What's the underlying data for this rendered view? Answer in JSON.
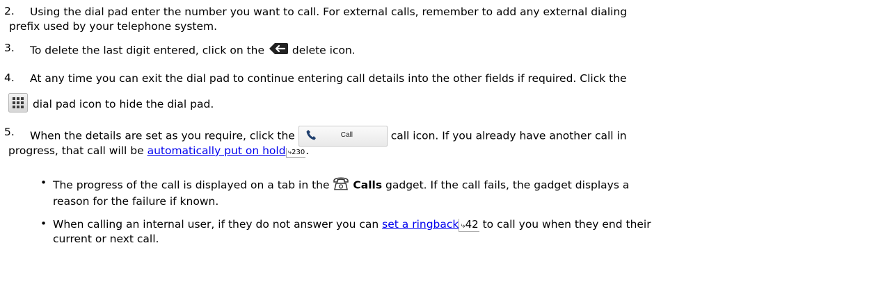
{
  "steps": [
    {
      "number": "2.",
      "line1": "Using the dial pad enter the number you want to call. For external calls, remember to add any external dialing",
      "line2": "prefix used by your telephone system."
    },
    {
      "number": "3.",
      "before": "To delete the last digit entered, click on the",
      "after": "delete icon."
    },
    {
      "number": "4.",
      "line1": "At any time you can exit the dial pad to continue entering call details into the other fields if required. Click the",
      "line2": "dial pad icon to hide the dial pad."
    },
    {
      "number": "5.",
      "before": "When the details are set as you require, click the",
      "button_label": "Call",
      "after": "call icon. If you already have another call in",
      "line2_before": "progress, that call will be",
      "link": "automatically put on hold",
      "link_ref": "230",
      "line2_after": "."
    }
  ],
  "bullets": [
    {
      "dot": "•",
      "before": "The progress of the call is displayed on a tab in the",
      "bold": "Calls",
      "after": "gadget. If the call fails, the gadget displays a",
      "line2": "reason for the failure if known."
    },
    {
      "dot": "•",
      "before": "When calling an internal user, if they do not answer you can",
      "link": "set a ringback",
      "link_ref": "42",
      "after": "to call you when they end their",
      "line2": "current or next call."
    }
  ],
  "icons": {
    "delete": "backspace-delete-icon",
    "dialpad": "dial-pad-grid-icon",
    "call": "phone-handset-icon",
    "calls_gadget": "telephone-icon",
    "ref_arrow": "jump-arrow-icon"
  },
  "colors": {
    "link": "#0000ee",
    "text": "#000000"
  }
}
